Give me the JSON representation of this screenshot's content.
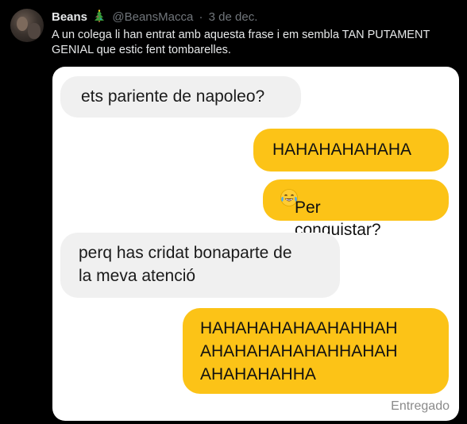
{
  "tweet": {
    "author_name": "Beans",
    "author_emoji": "christmas-tree-icon",
    "handle": "@BeansMacca",
    "separator": "·",
    "date": "3 de dec.",
    "text": "A un colega li han entrat amb aquesta frase i em sembla TAN PUTAMENT GENIAL que estic fent tombarelles."
  },
  "chat": {
    "messages": [
      {
        "side": "received",
        "lines": [
          "ets pariente de napoleo?"
        ]
      },
      {
        "side": "sent",
        "lines": [
          "HAHAHAHAHAHA"
        ]
      },
      {
        "side": "sent",
        "lines": [
          "Per conquistar?"
        ],
        "emoji": "laughing-tears-icon"
      },
      {
        "side": "received",
        "lines": [
          "perq has cridat bonaparte de",
          "la meva atenció"
        ]
      },
      {
        "side": "sent",
        "lines": [
          "HAHAHAHAHAAHAHHAH",
          "AHAHAHAHAHAHHAHAH",
          "AHAHAHAHHA"
        ]
      }
    ],
    "delivery_status": "Entregado"
  },
  "colors": {
    "background": "#000000",
    "sent_bubble": "#fcc317",
    "received_bubble": "#f0f0f0",
    "secondary_text": "#71767b"
  }
}
